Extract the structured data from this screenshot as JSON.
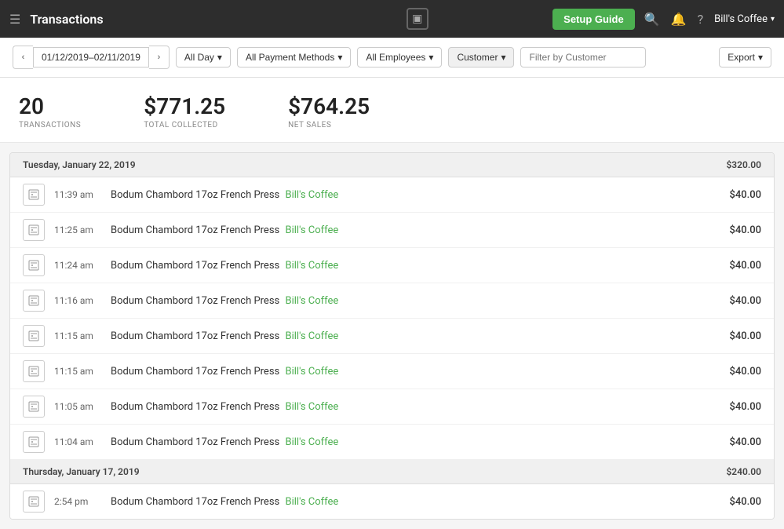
{
  "nav": {
    "app_title": "Transactions",
    "setup_guide_label": "Setup Guide",
    "user_menu_label": "Bill's Coffee",
    "square_icon": "▣"
  },
  "filters": {
    "prev_arrow": "‹",
    "next_arrow": "›",
    "date_range": "01/12/2019–02/11/2019",
    "date_range_chevron": "▾",
    "all_day_label": "All Day",
    "all_day_chevron": "▾",
    "payment_methods_label": "All Payment Methods",
    "payment_methods_chevron": "▾",
    "employees_label": "All Employees",
    "employees_chevron": "▾",
    "customer_label": "Customer",
    "customer_chevron": "▾",
    "filter_placeholder": "Filter by Customer",
    "export_label": "Export",
    "export_chevron": "▾"
  },
  "stats": {
    "transactions_count": "20",
    "transactions_label": "TRANSACTIONS",
    "total_collected": "$771.25",
    "total_collected_label": "TOTAL COLLECTED",
    "net_sales": "$764.25",
    "net_sales_label": "NET SALES"
  },
  "groups": [
    {
      "date_label": "Tuesday, January 22, 2019",
      "group_total": "$320.00",
      "transactions": [
        {
          "time": "11:39 am",
          "item": "Bodum Chambord 17oz French Press",
          "location": "Bill's Coffee",
          "amount": "$40.00"
        },
        {
          "time": "11:25 am",
          "item": "Bodum Chambord 17oz French Press",
          "location": "Bill's Coffee",
          "amount": "$40.00"
        },
        {
          "time": "11:24 am",
          "item": "Bodum Chambord 17oz French Press",
          "location": "Bill's Coffee",
          "amount": "$40.00"
        },
        {
          "time": "11:16 am",
          "item": "Bodum Chambord 17oz French Press",
          "location": "Bill's Coffee",
          "amount": "$40.00"
        },
        {
          "time": "11:15 am",
          "item": "Bodum Chambord 17oz French Press",
          "location": "Bill's Coffee",
          "amount": "$40.00"
        },
        {
          "time": "11:15 am",
          "item": "Bodum Chambord 17oz French Press",
          "location": "Bill's Coffee",
          "amount": "$40.00"
        },
        {
          "time": "11:05 am",
          "item": "Bodum Chambord 17oz French Press",
          "location": "Bill's Coffee",
          "amount": "$40.00"
        },
        {
          "time": "11:04 am",
          "item": "Bodum Chambord 17oz French Press",
          "location": "Bill's Coffee",
          "amount": "$40.00"
        }
      ]
    },
    {
      "date_label": "Thursday, January 17, 2019",
      "group_total": "$240.00",
      "transactions": [
        {
          "time": "2:54 pm",
          "item": "Bodum Chambord 17oz French Press",
          "location": "Bill's Coffee",
          "amount": "$40.00"
        }
      ]
    }
  ]
}
